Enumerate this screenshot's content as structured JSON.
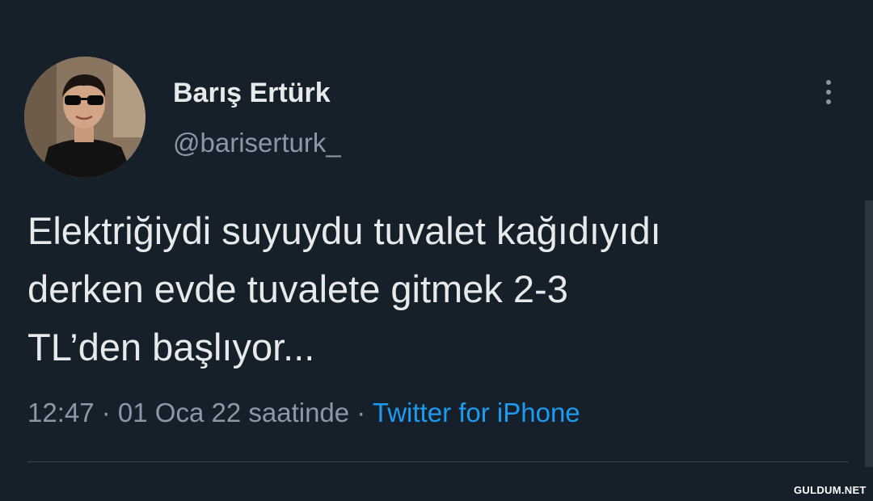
{
  "tweet": {
    "author": {
      "display_name": "Barış Ertürk",
      "handle": "@bariserturk_"
    },
    "text": "Elektriğiydi suyuydu tuvalet kağıdıyıdı\nderken evde tuvalete gitmek 2-3\nTL’den başlıyor...",
    "meta": {
      "time": "12:47",
      "separator1": " · ",
      "date": "01 Oca 22 saatinde",
      "separator2": " · ",
      "source": "Twitter for iPhone"
    },
    "more_icon": "more-vertical-icon"
  },
  "watermark": "GULDUM.NET",
  "colors": {
    "background": "#15202b",
    "primary_text": "#e7e9ea",
    "secondary_text": "#8b98a5",
    "accent": "#1d9bf0"
  }
}
